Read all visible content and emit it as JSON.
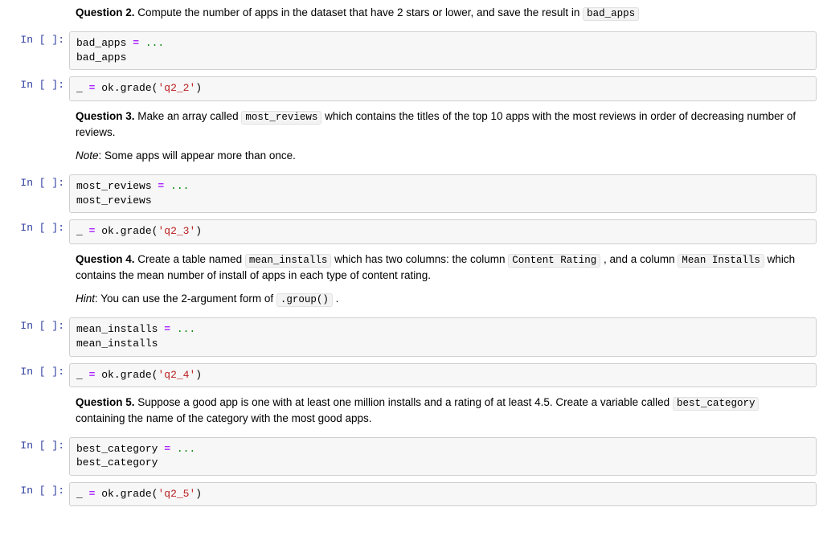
{
  "prompt_label": "In [ ]:",
  "q2": {
    "label": "Question 2.",
    "text_a": " Compute the number of apps in the dataset that have 2 stars or lower, and save the result in ",
    "code_a": "bad_apps",
    "code_line1a": "bad_apps ",
    "code_eq": "=",
    "code_line1b": " ...",
    "code_line2": "bad_apps",
    "grade_a": "_ ",
    "grade_b": " ok",
    "grade_c": ".",
    "grade_d": "grade",
    "grade_e": "(",
    "grade_s": "'q2_2'",
    "grade_f": ")"
  },
  "q3": {
    "label": "Question 3.",
    "text_a": " Make an array called ",
    "code_a": "most_reviews",
    "text_b": " which contains the titles of the top 10 apps with the most reviews in order of decreasing number of reviews.",
    "note_label": "Note",
    "note_text": ": Some apps will appear more than once.",
    "code_line1a": "most_reviews ",
    "code_line1b": " ...",
    "code_line2": "most_reviews",
    "grade_s": "'q2_3'"
  },
  "q4": {
    "label": "Question 4.",
    "text_a": " Create a table named ",
    "code_a": "mean_installs",
    "text_b": " which has two columns: the column ",
    "code_b": "Content Rating",
    "text_c": " , and a column ",
    "code_c": "Mean Installs",
    "text_d": " which contains the mean number of install of apps in each type of content rating.",
    "hint_label": "Hint",
    "hint_text_a": ": You can use the 2-argument form of ",
    "hint_code": ".group()",
    "hint_text_b": " .",
    "code_line1a": "mean_installs ",
    "code_line1b": " ...",
    "code_line2": "mean_installs",
    "grade_s": "'q2_4'"
  },
  "q5": {
    "label": "Question 5.",
    "text_a": " Suppose a good app is one with at least one million installs and a rating of at least 4.5. Create a variable called ",
    "code_a": "best_category",
    "text_b": " containing the name of the category with the most good apps.",
    "code_line1a": "best_category ",
    "code_line1b": " ...",
    "code_line2": "best_category",
    "grade_s": "'q2_5'"
  }
}
